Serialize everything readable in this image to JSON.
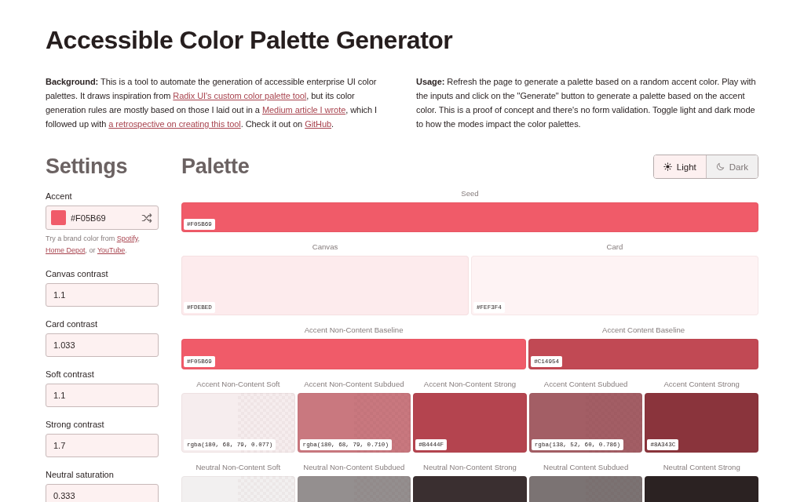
{
  "title": "Accessible Color Palette Generator",
  "intro": [
    {
      "segments": [
        {
          "kind": "text",
          "text": "**Background:** This is a tool to automate the generation of accessible enterprise UI color palettes. It draws inspiration from "
        },
        {
          "kind": "link",
          "text": "Radix UI's custom color palette tool"
        },
        {
          "kind": "text",
          "text": ", but its color generation rules are mostly based on those I laid out in a "
        },
        {
          "kind": "link",
          "text": "Medium article I wrote"
        },
        {
          "kind": "text",
          "text": ", which I followed up with "
        },
        {
          "kind": "link",
          "text": "a retrospective on creating this tool"
        },
        {
          "kind": "text",
          "text": ". Check it out on "
        },
        {
          "kind": "link",
          "text": "GitHub"
        },
        {
          "kind": "text",
          "text": "."
        }
      ]
    },
    {
      "segments": [
        {
          "kind": "text",
          "text": "**Usage:** Refresh the page to generate a palette based on a random accent color. Play with the inputs and click on the \"Generate\" button to generate a palette based on the accent color. This is a proof of concept and there's no form validation. Toggle light and dark mode to how the modes impact the color palettes."
        }
      ]
    }
  ],
  "settings": {
    "title": "Settings",
    "accent": {
      "label": "Accent",
      "color": "#f05b69",
      "value": "#F05B69",
      "hint": [
        {
          "kind": "text",
          "text": "Try a brand color from "
        },
        {
          "kind": "link",
          "text": "Spotify"
        },
        {
          "kind": "text",
          "text": ", "
        },
        {
          "kind": "link",
          "text": "Home Depot"
        },
        {
          "kind": "text",
          "text": ", or "
        },
        {
          "kind": "link",
          "text": "YouTube"
        },
        {
          "kind": "text",
          "text": "."
        }
      ]
    },
    "fields": [
      {
        "label": "Canvas contrast",
        "value": "1.1"
      },
      {
        "label": "Card contrast",
        "value": "1.033"
      },
      {
        "label": "Soft contrast",
        "value": "1.1"
      },
      {
        "label": "Strong contrast",
        "value": "1.7"
      },
      {
        "label": "Neutral saturation",
        "value": "0.333"
      }
    ]
  },
  "palette": {
    "title": "Palette",
    "modes": [
      {
        "label": "Light",
        "selected": true
      },
      {
        "label": "Dark",
        "selected": false
      }
    ],
    "rows": [
      {
        "kind": "full",
        "swatches": [
          {
            "name": "Seed",
            "kind": "solid",
            "color": "#f05b69",
            "code": "#F05B69"
          }
        ]
      },
      {
        "kind": "pair",
        "swatches": [
          {
            "name": "Canvas",
            "kind": "solid",
            "color": "#fdebed",
            "code": "#FDEBED"
          },
          {
            "name": "Card",
            "kind": "solid",
            "color": "#fef3f4",
            "code": "#FEF3F4"
          }
        ]
      },
      {
        "kind": "split",
        "swatches": [
          {
            "name": "Accent Non-Content Baseline",
            "kind": "solid",
            "color": "#f05b69",
            "code": "#F05B69"
          },
          {
            "name": "Accent Content Baseline",
            "kind": "solid",
            "color": "#c14954",
            "code": "#C14954"
          }
        ]
      },
      {
        "kind": "five",
        "swatches": [
          {
            "name": "Accent Non-Content Soft",
            "kind": "translucent",
            "color": "#f6edee",
            "code": "rgba(180, 68, 79, 0.077)"
          },
          {
            "name": "Accent Non-Content Subdued",
            "kind": "translucent",
            "color": "#c9787f",
            "code": "rgba(180, 68, 79, 0.710)"
          },
          {
            "name": "Accent Non-Content Strong",
            "kind": "solid",
            "color": "#b4444f",
            "code": "#B4444F"
          },
          {
            "name": "Accent Content Subdued",
            "kind": "translucent",
            "color": "#a35e65",
            "code": "rgba(138, 52, 60, 0.786)"
          },
          {
            "name": "Accent Content Strong",
            "kind": "solid",
            "color": "#8a343c",
            "code": "#8A343C"
          }
        ]
      },
      {
        "kind": "five",
        "swatches": [
          {
            "name": "Neutral Non-Content Soft",
            "kind": "translucent",
            "color": "#f2f0f0"
          },
          {
            "name": "Neutral Non-Content Subdued",
            "kind": "translucent",
            "color": "#948f8f"
          },
          {
            "name": "Neutral Non-Content Strong",
            "kind": "solid",
            "color": "#3a2f30"
          },
          {
            "name": "Neutral Content Subdued",
            "kind": "translucent",
            "color": "#7b7373"
          },
          {
            "name": "Neutral Content Strong",
            "kind": "solid",
            "color": "#2b2222"
          }
        ]
      }
    ]
  }
}
